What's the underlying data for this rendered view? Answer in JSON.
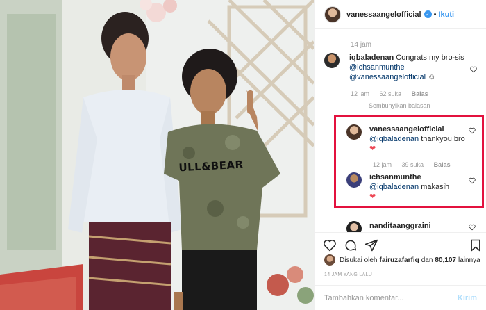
{
  "post": {
    "photo_shirt_text": "ULL&BEAR"
  },
  "header": {
    "username": "vanessaangelofficial",
    "verified_icon": "verified-badge-icon",
    "separator": "•",
    "follow_label": "Ikuti"
  },
  "comments": {
    "caption_time": "14 jam",
    "items": [
      {
        "username": "iqbaladenan",
        "text_prefix": "Congrats my bro-sis",
        "mention1": "@ichsanmunthe",
        "mention2": "@vanessaangelofficial",
        "emoji": "☺",
        "time": "12 jam",
        "likes": "62 suka",
        "reply": "Balas"
      },
      {
        "username": "vanessaangelofficial",
        "mention": "@iqbaladenan",
        "text": "thankyou bro",
        "emoji": "❤",
        "time": "12 jam",
        "likes": "39 suka",
        "reply": "Balas"
      },
      {
        "username": "ichsanmunthe",
        "mention": "@iqbaladenan",
        "text": "makasih",
        "emoji": "❤"
      },
      {
        "username": "nanditaanggraini"
      }
    ],
    "hide_replies": "Sembunyikan balasan"
  },
  "actions": {
    "like_icon": "heart-icon",
    "comment_icon": "comment-icon",
    "share_icon": "share-icon",
    "save_icon": "bookmark-icon"
  },
  "likes": {
    "prefix": "Disukai oleh",
    "user": "fairuzafarfiq",
    "connector": "dan",
    "count": "80,107",
    "suffix": "lainnya"
  },
  "timestamp": "14 JAM YANG LALU",
  "composer": {
    "placeholder": "Tambahkan komentar...",
    "send_label": "Kirim"
  },
  "colors": {
    "accent": "#3897f0",
    "highlight_border": "#e3113e",
    "heart": "#ed4956"
  }
}
